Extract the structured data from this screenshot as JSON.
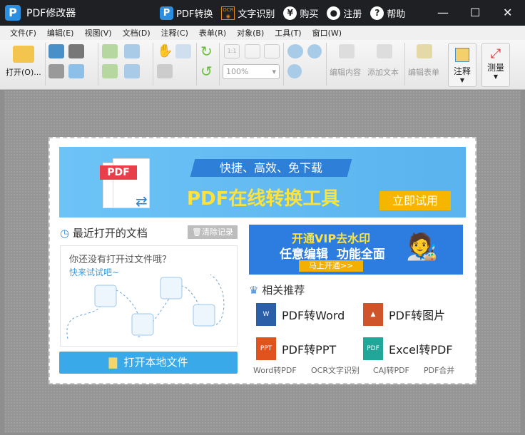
{
  "titlebar": {
    "app_title": "PDF修改器",
    "actions": [
      "PDF转换",
      "文字识别",
      "购买",
      "注册",
      "帮助"
    ]
  },
  "menu": [
    "文件(F)",
    "编辑(E)",
    "视图(V)",
    "文档(D)",
    "注释(C)",
    "表单(R)",
    "对象(B)",
    "工具(T)",
    "窗口(W)"
  ],
  "toolbar": {
    "open": "打开(O)...",
    "zoom": "100%",
    "edit_content": "编辑内容",
    "add_text": "添加文本",
    "edit_form": "编辑表单",
    "annotate": "注释",
    "measure": "测量"
  },
  "banner": {
    "logo_text": "PDF",
    "slogan": "快捷、高效、免下载",
    "title": "PDF在线转换工具",
    "button": "立即试用"
  },
  "recent": {
    "heading": "最近打开的文档",
    "clear": "清除记录",
    "empty_text": "你还没有打开过文件哦？",
    "try_link": "快来试试吧~",
    "open_local": "打开本地文件"
  },
  "vip": {
    "line1": "开通VIP去水印",
    "line2": "任意编辑  功能全面",
    "button": "马上开通>>"
  },
  "recommend": {
    "heading": "相关推荐",
    "items": [
      {
        "label": "PDF转Word",
        "color": "#2b5fa8"
      },
      {
        "label": "PDF转图片",
        "color": "#d0542a"
      },
      {
        "label": "PDF转PPT",
        "color": "#e0531f"
      },
      {
        "label": "Excel转PDF",
        "color": "#22a69a"
      }
    ],
    "links": [
      "Word转PDF",
      "OCR文字识别",
      "CAJ转PDF",
      "PDF合并"
    ]
  }
}
